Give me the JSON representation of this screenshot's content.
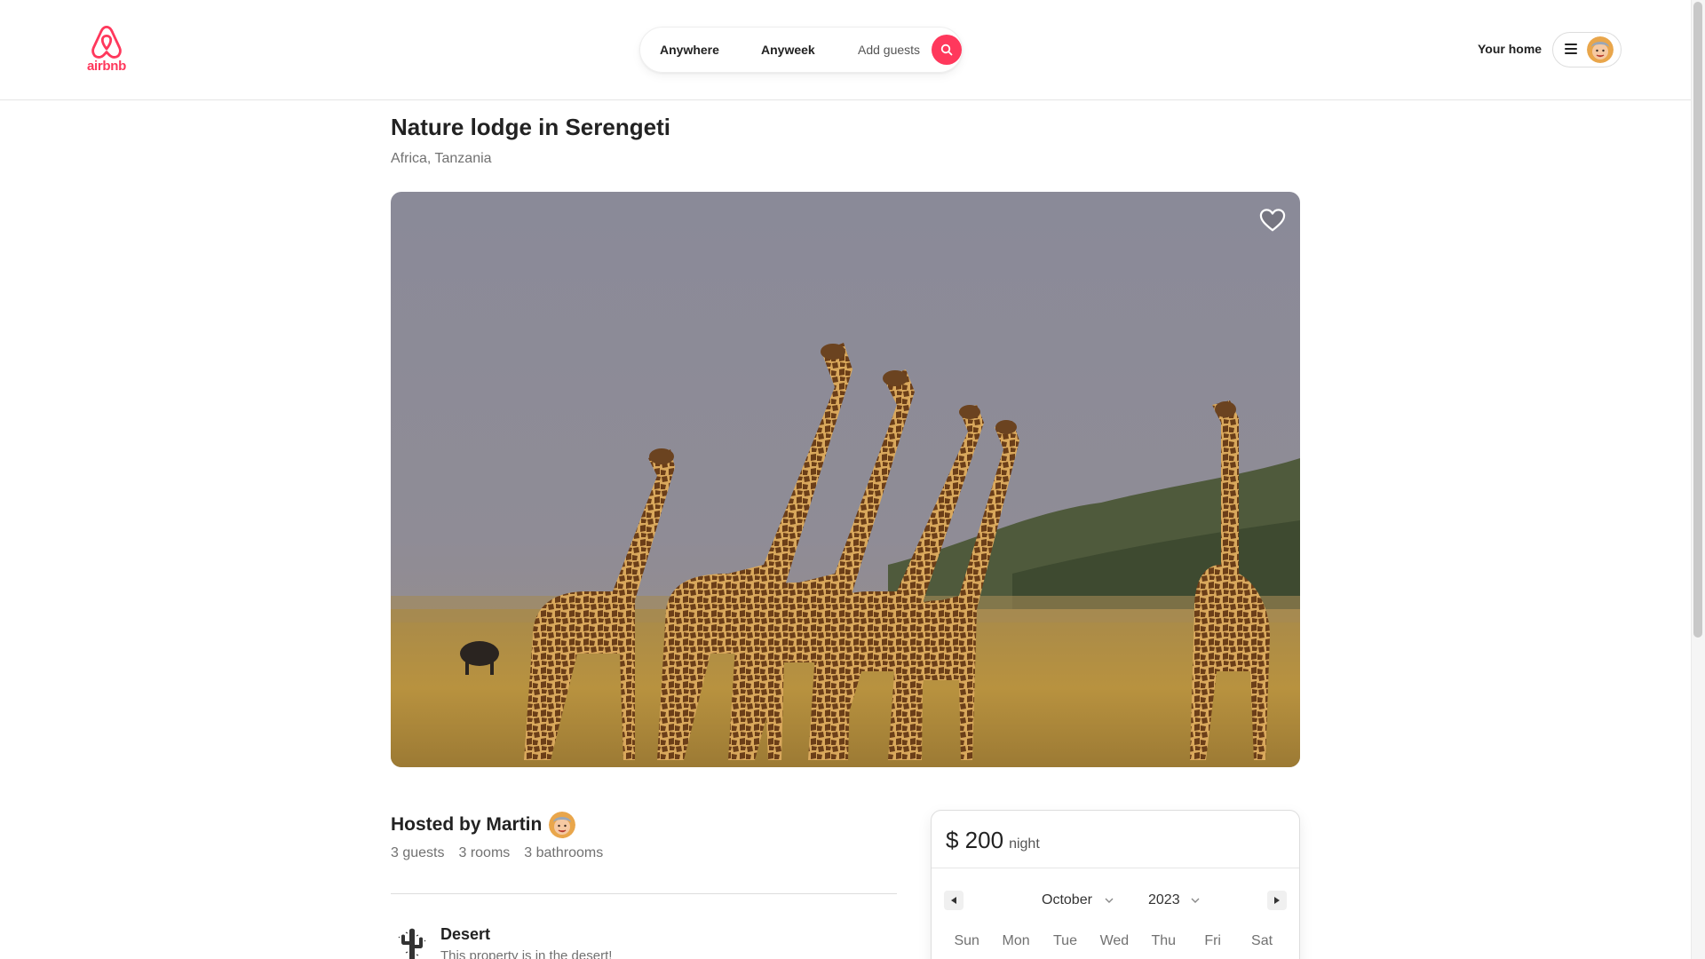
{
  "brand": {
    "logo_text": "airbnb",
    "accent": "#ff385c"
  },
  "search": {
    "anywhere": "Anywhere",
    "anyweek": "Anyweek",
    "guests": "Add guests",
    "icon": "search-icon"
  },
  "nav": {
    "your_home": "Your home",
    "menu_icon": "hamburger-icon",
    "avatar_icon": "user-avatar"
  },
  "listing": {
    "title": "Nature lodge in Serengeti",
    "location": "Africa, Tanzania",
    "favorite_icon": "heart-icon"
  },
  "host": {
    "hosted_by": "Hosted by Martin",
    "stats": [
      "3 guests",
      "3 rooms",
      "3 bathrooms"
    ]
  },
  "feature": {
    "icon": "cactus-icon",
    "title": "Desert",
    "description": "This property is in the desert!"
  },
  "booking": {
    "price": "$ 200",
    "unit": "night",
    "month": "October",
    "year": "2023",
    "weekdays": [
      "Sun",
      "Mon",
      "Tue",
      "Wed",
      "Thu",
      "Fri",
      "Sat"
    ]
  }
}
